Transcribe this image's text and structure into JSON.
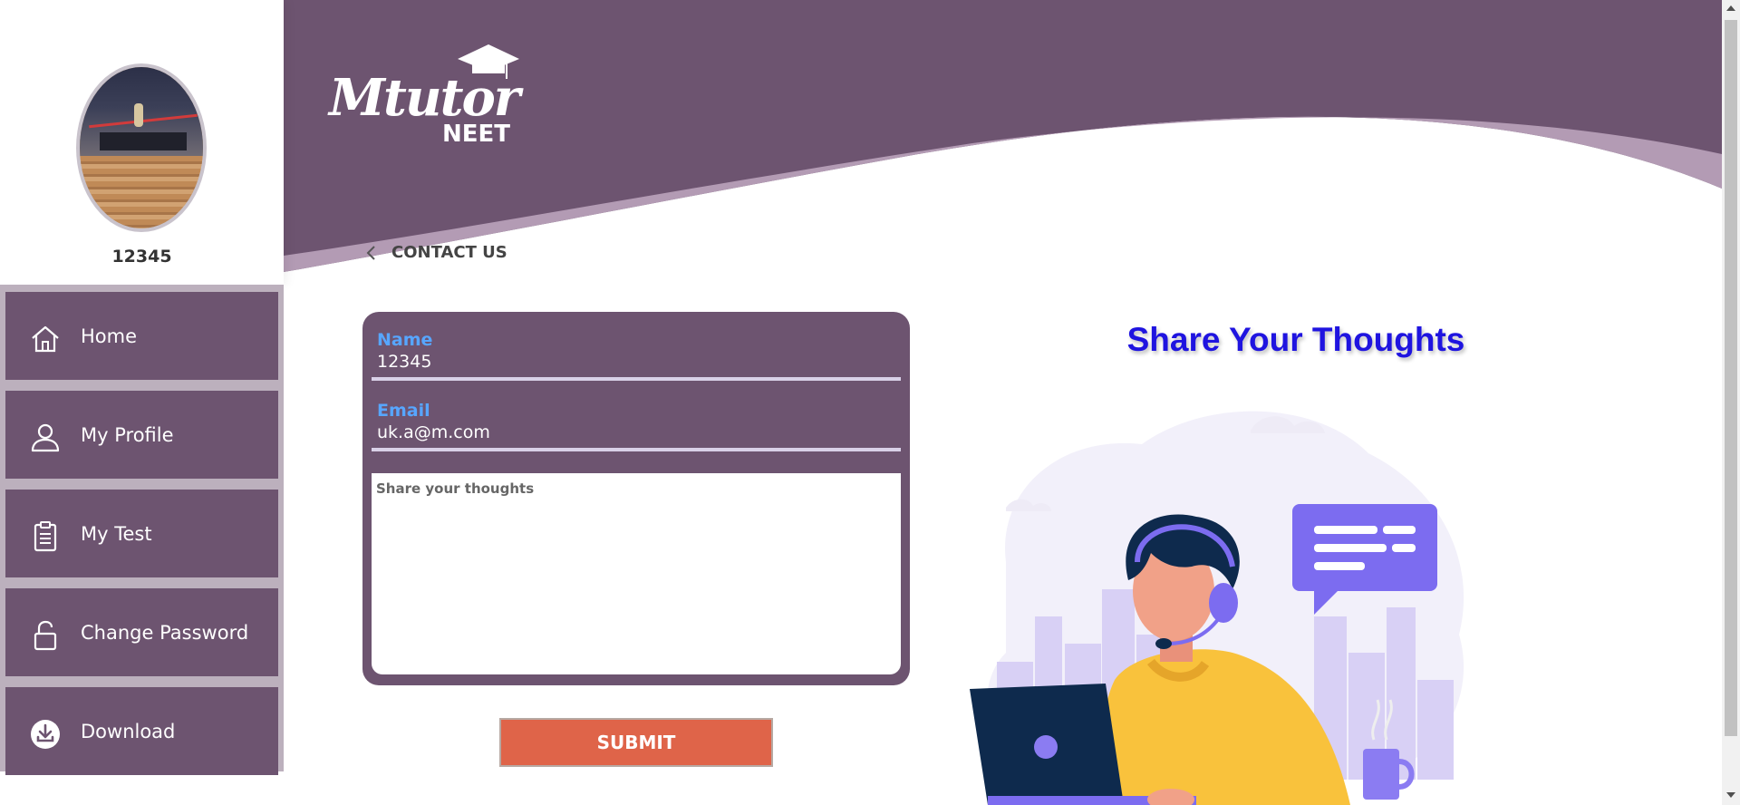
{
  "sidebar": {
    "user_id": "12345",
    "items": [
      {
        "label": "Home",
        "icon": "home-icon"
      },
      {
        "label": "My Profile",
        "icon": "user-icon"
      },
      {
        "label": "My Test",
        "icon": "clipboard-icon"
      },
      {
        "label": "Change Password",
        "icon": "lock-icon"
      },
      {
        "label": "Download",
        "icon": "download-icon"
      }
    ]
  },
  "header": {
    "logo_word": "Mtutor",
    "logo_sub": "NEET"
  },
  "breadcrumb": {
    "label": "CONTACT US"
  },
  "form": {
    "name_label": "Name",
    "name_value": "12345",
    "email_label": "Email",
    "email_value": "uk.a@m.com",
    "thoughts_placeholder": "Share your thoughts",
    "submit_label": "SUBMIT"
  },
  "aside": {
    "title": "Share Your Thoughts"
  },
  "colors": {
    "brand_purple": "#6d5470",
    "nav_bg": "#bcb0bd",
    "label_blue": "#57a6ff",
    "submit_orange": "#df6449",
    "title_blue": "#1f14e0"
  }
}
